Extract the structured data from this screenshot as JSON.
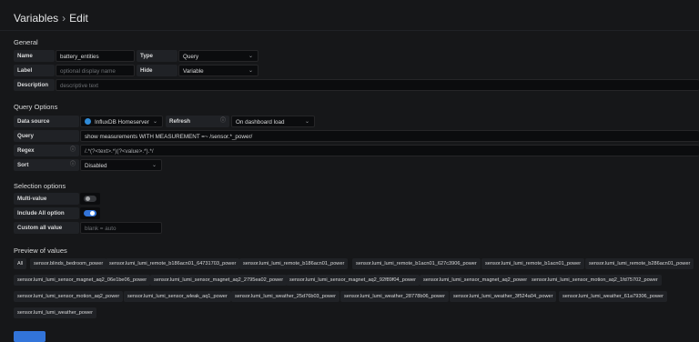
{
  "header": {
    "crumb": "Variables",
    "separator": "›",
    "page": "Edit"
  },
  "general": {
    "heading": "General",
    "name_label": "Name",
    "name_value": "battery_entities",
    "type_label": "Type",
    "type_value": "Query",
    "label_label": "Label",
    "label_placeholder": "optional display name",
    "hide_label": "Hide",
    "hide_value": "Variable",
    "description_label": "Description",
    "description_placeholder": "descriptive text"
  },
  "query_options": {
    "heading": "Query Options",
    "datasource_label": "Data source",
    "datasource_value": "InfluxDB Homeserver",
    "refresh_label": "Refresh",
    "refresh_value": "On dashboard load",
    "query_label": "Query",
    "query_value": "show measurements WITH MEASUREMENT =~ /sensor.*_power/",
    "regex_label": "Regex",
    "regex_value": "/.*(?<text>.*)(?<value>.*).*/",
    "sort_label": "Sort",
    "sort_value": "Disabled"
  },
  "selection": {
    "heading": "Selection options",
    "multi_label": "Multi-value",
    "multi_on": false,
    "include_all_label": "Include All option",
    "include_all_on": true,
    "custom_all_label": "Custom all value",
    "custom_all_placeholder": "blank = auto"
  },
  "preview": {
    "heading": "Preview of values",
    "values": [
      "All",
      "sensor.blinds_bedroom_power",
      "sensor.lumi_lumi_remote_b186acn01_64731703_power",
      "sensor.lumi_lumi_remote_b186acn01_power",
      "sensor.lumi_lumi_remote_b1acn01_627c3906_power",
      "sensor.lumi_lumi_remote_b1acn01_power",
      "sensor.lumi_lumi_remote_b286acn01_power",
      "sensor.lumi_lumi_sensor_magnet_aq2_06e1be06_power",
      "sensor.lumi_lumi_sensor_magnet_aq2_2795ea02_power",
      "sensor.lumi_lumi_sensor_magnet_aq2_92f89f04_power",
      "sensor.lumi_lumi_sensor_magnet_aq2_power",
      "sensor.lumi_lumi_sensor_motion_aq2_1fd75702_power",
      "sensor.lumi_lumi_sensor_motion_aq2_power",
      "sensor.lumi_lumi_sensor_wleak_aq1_power",
      "sensor.lumi_lumi_weather_25d76b03_power",
      "sensor.lumi_lumi_weather_28778b06_power",
      "sensor.lumi_lumi_weather_3f524a04_power",
      "sensor.lumi_lumi_weather_61a79306_power",
      "sensor.lumi_lumi_weather_power"
    ]
  },
  "colors": {
    "accent": "#3274d9",
    "background": "#161719",
    "panel": "#202226",
    "input": "#0b0c0e"
  }
}
